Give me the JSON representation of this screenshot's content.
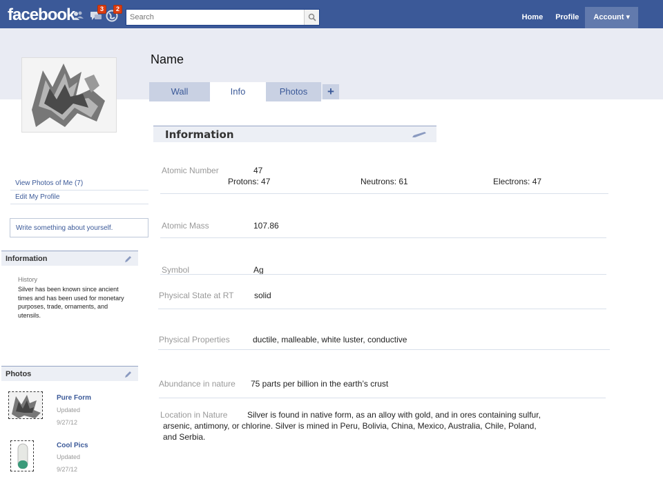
{
  "topbar": {
    "logo": "facebook",
    "badges": {
      "messages": "3",
      "notifications": "2"
    },
    "search_placeholder": "Search",
    "nav": {
      "home": "Home",
      "profile": "Profile",
      "account": "Account ▾"
    }
  },
  "profile": {
    "name": "Name",
    "tabs": {
      "wall": "Wall",
      "info": "Info",
      "photos": "Photos",
      "add": "+"
    }
  },
  "left": {
    "view_photos": "View Photos of Me (7)",
    "edit_profile": "Edit My Profile",
    "about_placeholder": "Write something about yourself.",
    "information_header": "Information",
    "history_label": "History",
    "history_text": "Silver has been known since ancient times and has been used for monetary purposes, trade, ornaments, and utensils.",
    "photos_header": "Photos",
    "albums": [
      {
        "title": "Pure Form",
        "updated": "Updated",
        "date": "9/27/12"
      },
      {
        "title": "Cool Pics",
        "updated": "Updated",
        "date": "9/27/12"
      }
    ]
  },
  "info": {
    "header": "Information",
    "atomic_number_label": "Atomic Number",
    "atomic_number": "47",
    "protons": "Protons: 47",
    "neutrons": "Neutrons: 61",
    "electrons": "Electrons: 47",
    "atomic_mass_label": "Atomic Mass",
    "atomic_mass": "107.86",
    "symbol_label": "Symbol",
    "symbol": "Ag",
    "state_label": "Physical State at RT",
    "state": "solid",
    "properties_label": "Physical Properties",
    "properties": "ductile, malleable, white luster, conductive",
    "abundance_label": "Abundance in nature",
    "abundance": "75 parts per billion in the earth’s crust",
    "location_label": "Location in Nature",
    "location_line1": "Silver is found in native form, as an alloy with gold, and in ores containing sulfur,",
    "location_line2": "arsenic, antimony, or chlorine. Silver is mined in Peru, Bolivia, China, Mexico, Australia, Chile, Poland,",
    "location_line3": "and Serbia."
  },
  "colors": {
    "brand": "#3b5998",
    "band": "#e9ebf3",
    "tab": "#c9d1e3",
    "badge": "#dd3c10"
  }
}
